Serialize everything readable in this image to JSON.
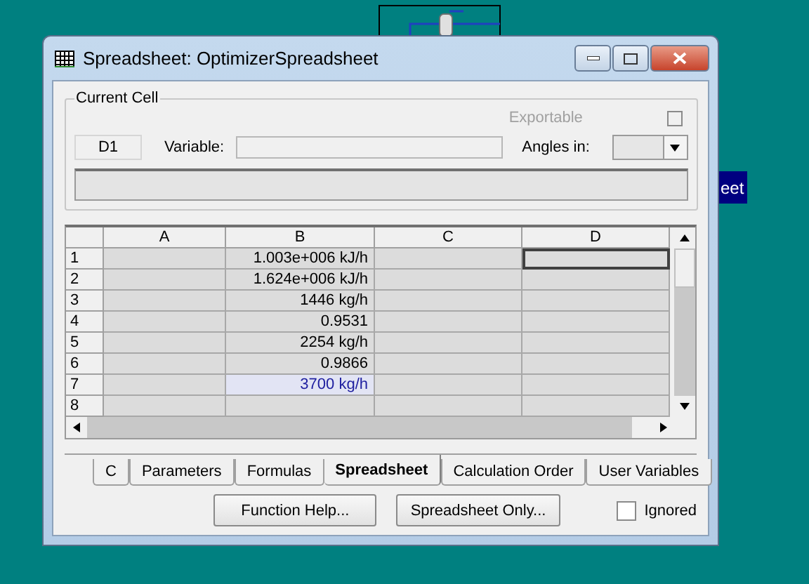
{
  "background": {
    "label": "eet"
  },
  "window": {
    "title": "Spreadsheet: OptimizerSpreadsheet"
  },
  "current_cell": {
    "legend": "Current Cell",
    "cell": "D1",
    "variable_label": "Variable:",
    "exportable": {
      "label": "Exportable",
      "checked": false,
      "disabled": true
    },
    "angles_label": "Angles in:"
  },
  "grid": {
    "columns": [
      "A",
      "B",
      "C",
      "D"
    ],
    "rows": [
      {
        "label": "1",
        "cells": [
          {
            "selected": false
          },
          {
            "text": "1.003e+006 kJ/h",
            "selected": false
          },
          {
            "selected": false
          },
          {
            "selected": true
          }
        ]
      },
      {
        "label": "2",
        "cells": [
          {
            "selected": false
          },
          {
            "text": "1.624e+006 kJ/h",
            "selected": false
          },
          {
            "selected": false
          },
          {
            "selected": false
          }
        ]
      },
      {
        "label": "3",
        "cells": [
          {
            "selected": false
          },
          {
            "text": "1446 kg/h",
            "selected": false
          },
          {
            "selected": false
          },
          {
            "selected": false
          }
        ]
      },
      {
        "label": "4",
        "cells": [
          {
            "selected": false
          },
          {
            "text": "0.9531",
            "selected": false
          },
          {
            "selected": false
          },
          {
            "selected": false
          }
        ]
      },
      {
        "label": "5",
        "cells": [
          {
            "selected": false
          },
          {
            "text": "2254 kg/h",
            "selected": false
          },
          {
            "selected": false
          },
          {
            "selected": false
          }
        ]
      },
      {
        "label": "6",
        "cells": [
          {
            "selected": false
          },
          {
            "text": "0.9866",
            "selected": false
          },
          {
            "selected": false
          },
          {
            "selected": false
          }
        ]
      },
      {
        "label": "7",
        "cells": [
          {
            "selected": false
          },
          {
            "text": "3700 kg/h",
            "selected": false,
            "specified": true
          },
          {
            "selected": false
          },
          {
            "selected": false
          }
        ]
      },
      {
        "label": "8",
        "cells": [
          {
            "selected": false
          },
          {
            "selected": false
          },
          {
            "selected": false
          },
          {
            "selected": false
          }
        ]
      }
    ]
  },
  "tabs": [
    {
      "label": "C",
      "selected": false
    },
    {
      "label": "Parameters",
      "selected": false
    },
    {
      "label": "Formulas",
      "selected": false
    },
    {
      "label": "Spreadsheet",
      "selected": true
    },
    {
      "label": "Calculation Order",
      "selected": false
    },
    {
      "label": "User Variables",
      "selected": false
    }
  ],
  "buttons": [
    "Function Help...",
    "Spreadsheet Only..."
  ],
  "ignored": {
    "label": "Ignored",
    "checked": false
  }
}
